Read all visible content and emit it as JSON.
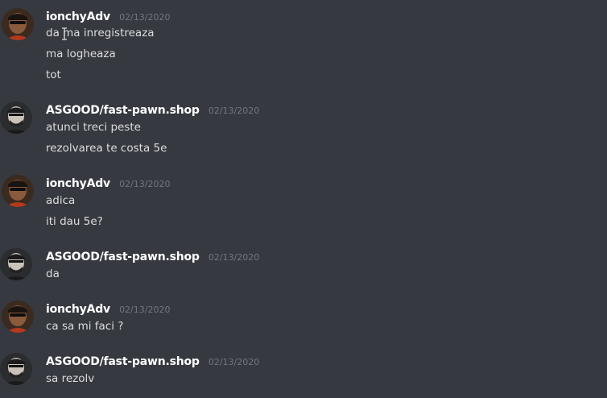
{
  "messages": [
    {
      "username": "ionchyAdv",
      "timestamp": "02/13/2020",
      "avatar": "user-avatar-ionchy",
      "lines": [
        "da ma inregistreaza",
        "ma logheaza",
        "tot"
      ]
    },
    {
      "username": "ASGOOD/fast-pawn.shop",
      "timestamp": "02/13/2020",
      "avatar": "user-avatar-asgood",
      "lines": [
        "atunci treci peste",
        "rezolvarea te costa 5e"
      ]
    },
    {
      "username": "ionchyAdv",
      "timestamp": "02/13/2020",
      "avatar": "user-avatar-ionchy",
      "lines": [
        "adica",
        "iti dau 5e?"
      ]
    },
    {
      "username": "ASGOOD/fast-pawn.shop",
      "timestamp": "02/13/2020",
      "avatar": "user-avatar-asgood",
      "lines": [
        "da"
      ]
    },
    {
      "username": "ionchyAdv",
      "timestamp": "02/13/2020",
      "avatar": "user-avatar-ionchy",
      "lines": [
        "ca sa mi faci ?"
      ]
    },
    {
      "username": "ASGOOD/fast-pawn.shop",
      "timestamp": "02/13/2020",
      "avatar": "user-avatar-asgood",
      "lines": [
        "sa rezolv"
      ]
    }
  ],
  "colors": {
    "background": "#36393f",
    "username": "#ffffff",
    "timestamp": "#72767d",
    "message_text": "#dcddde"
  }
}
